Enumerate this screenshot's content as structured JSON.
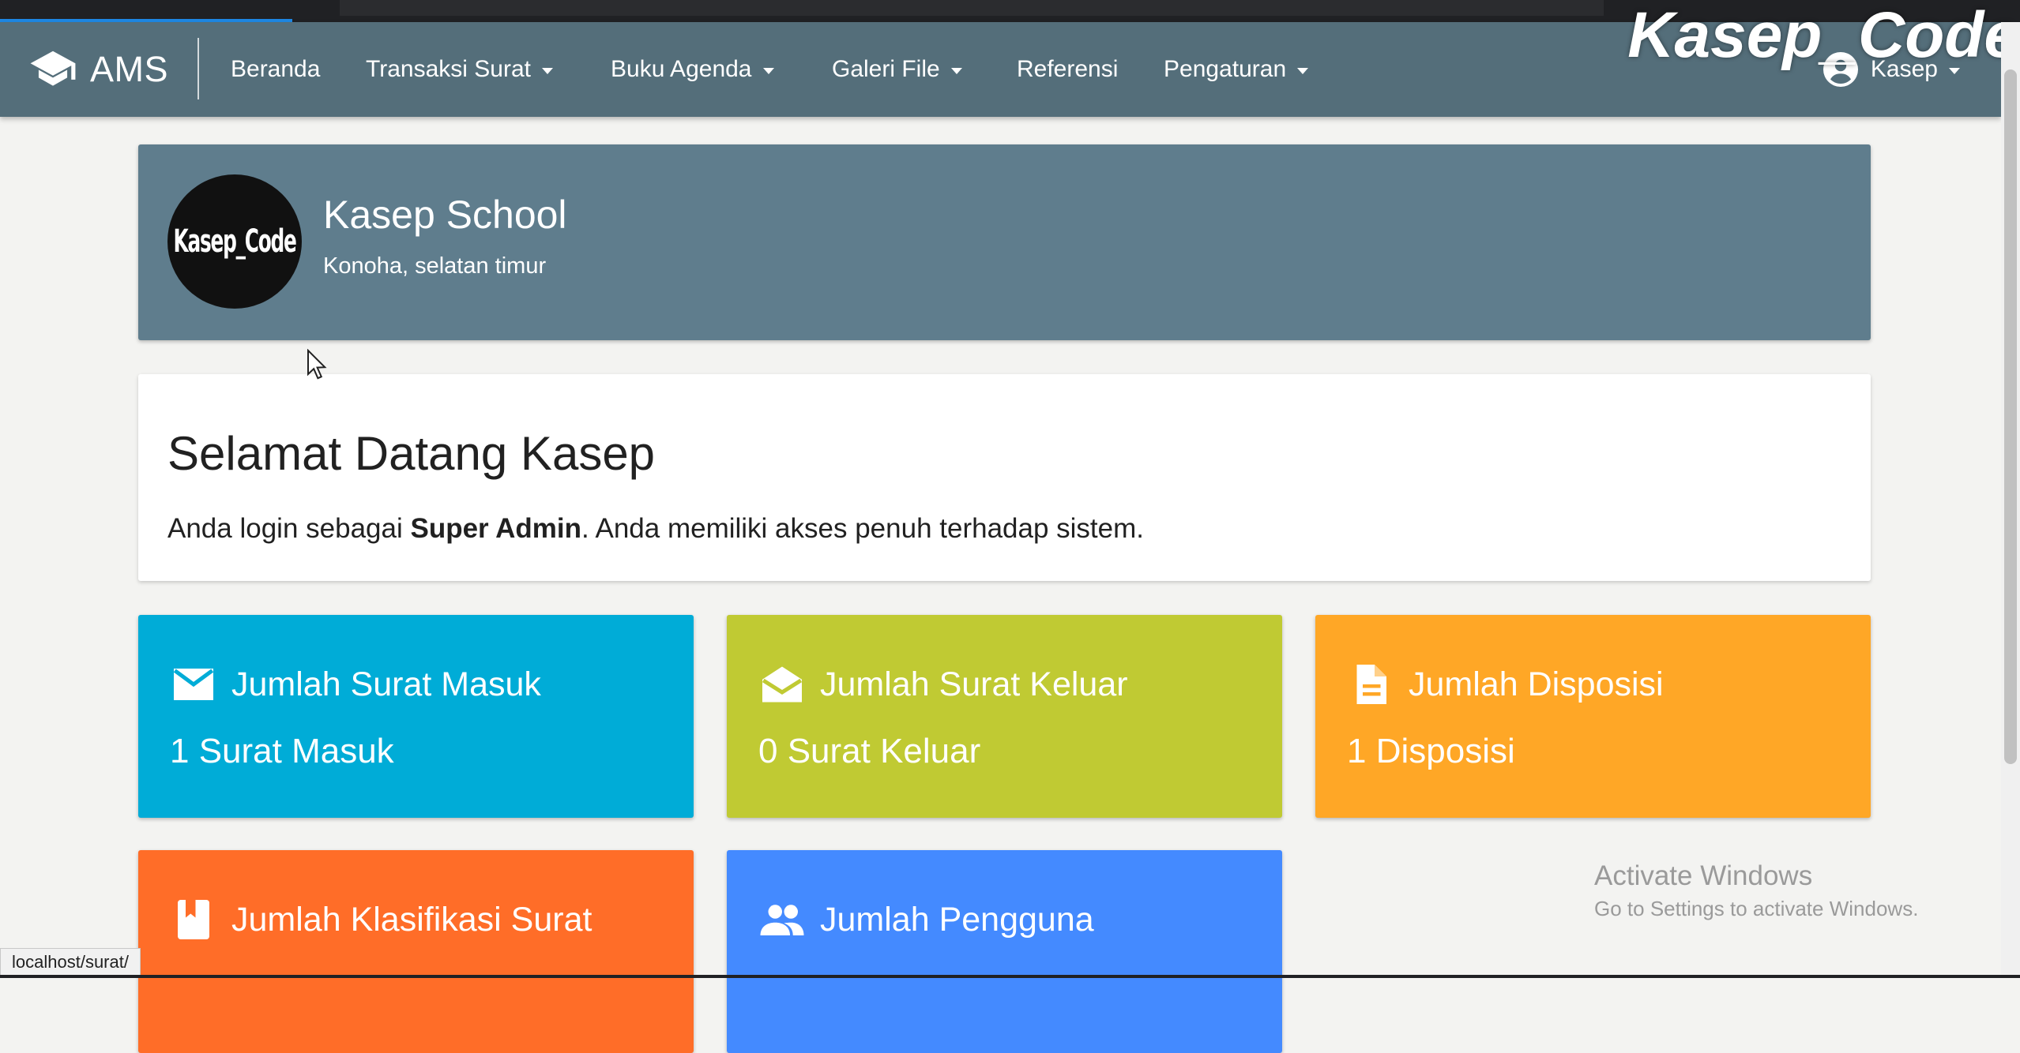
{
  "watermark": "Kasep_Code",
  "navbar": {
    "brand": "AMS",
    "items": [
      {
        "label": "Beranda",
        "dropdown": false
      },
      {
        "label": "Transaksi Surat",
        "dropdown": true
      },
      {
        "label": "Buku Agenda",
        "dropdown": true
      },
      {
        "label": "Galeri File",
        "dropdown": true
      },
      {
        "label": "Referensi",
        "dropdown": false
      },
      {
        "label": "Pengaturan",
        "dropdown": true
      }
    ],
    "user": "Kasep"
  },
  "school": {
    "logo_text": "Kasep_Code",
    "name": "Kasep School",
    "address": "Konoha, selatan timur"
  },
  "welcome": {
    "title": "Selamat Datang Kasep",
    "text_before": "Anda login sebagai ",
    "role": "Super Admin",
    "text_after": ". Anda memiliki akses penuh terhadap sistem."
  },
  "stats": [
    {
      "title": "Jumlah Surat Masuk",
      "value": "1 Surat Masuk",
      "icon": "mail-icon",
      "color": "#00acd7"
    },
    {
      "title": "Jumlah Surat Keluar",
      "value": "0 Surat Keluar",
      "icon": "mail-open-icon",
      "color": "#c0ca33"
    },
    {
      "title": "Jumlah Disposisi",
      "value": "1 Disposisi",
      "icon": "document-icon",
      "color": "#ffa726"
    },
    {
      "title": "Jumlah Klasifikasi Surat",
      "value": "",
      "icon": "bookmark-icon",
      "color": "#ff6d28"
    },
    {
      "title": "Jumlah Pengguna",
      "value": "",
      "icon": "people-icon",
      "color": "#448aff"
    }
  ],
  "status_bar_url": "localhost/surat/",
  "activate_windows": {
    "line1": "Activate Windows",
    "line2": "Go to Settings to activate Windows."
  }
}
